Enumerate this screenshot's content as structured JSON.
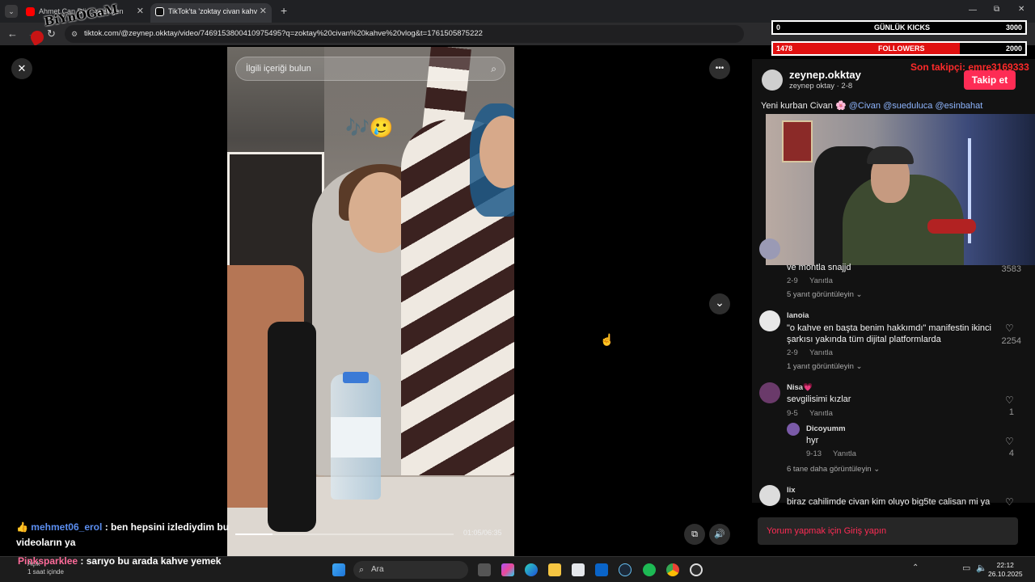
{
  "browser": {
    "tabs": [
      {
        "label": "Ahmet Can Dü... zgisi gen",
        "icon_color": "#ff0000"
      },
      {
        "label": "TikTok'ta 'zoktay civan kahv",
        "icon_color": "#ffffff"
      }
    ],
    "new_tab": "+",
    "url": "tiktok.com/@zeynep.okktay/video/7469153800410975495?q=zoktay%20civan%20kahve%20vlog&t=1761505875222",
    "window_controls": {
      "minimize": "—",
      "restore": "⧉",
      "close": "✕"
    }
  },
  "overlay_logo": "BiYnOGaM",
  "video": {
    "search_placeholder": "İlgili içeriği bulun",
    "time": "01:05/06:35",
    "progress": 0.17,
    "emoji": "🎶🥲",
    "close_icon": "✕",
    "more_icon": "•••",
    "chevron_icon": "⌄",
    "volume_icon": "🔊",
    "pip_icon": "⧉"
  },
  "stream": {
    "daily_kicks": {
      "label": "GÜNLÜK KICKS",
      "current": "0",
      "goal": "3000",
      "progress": 0.0
    },
    "followers": {
      "label": "FOLLOWERS",
      "current": "1478",
      "goal": "2000",
      "progress": 0.74
    },
    "last_follower": "Son takipçi: emre3169333"
  },
  "post": {
    "author": "zeynep.okktay",
    "author_sub": "zeynep oktay · 2-8",
    "follow": "Takip et",
    "desc_prefix": "Yeni kurban Civan",
    "mentions": [
      "@Civan",
      "@sueduluca",
      "@esinbahat"
    ]
  },
  "comments": [
    {
      "name": "",
      "text": "ve montla snajjd",
      "date": "2-9",
      "reply": "Yanıtla",
      "likes": "3583",
      "more": "5 yanıt görüntüleyin"
    },
    {
      "name": "lanoia",
      "text": "\"o kahve en başta benim hakkımdı\" manifestin ikinci şarkısı yakında tüm dijital platformlarda",
      "date": "2-9",
      "reply": "Yanıtla",
      "likes": "2254",
      "more": "1 yanıt görüntüleyin"
    },
    {
      "name": "Nisa💗",
      "text": "sevgilisimi kızlar",
      "date": "9-5",
      "reply": "Yanıtla",
      "likes": "1",
      "more": ""
    },
    {
      "name": "Dicoyumm",
      "text": "hyr",
      "date": "9-13",
      "reply": "Yanıtla",
      "likes": "4",
      "more": "6 tane daha görüntüleyin"
    },
    {
      "name": "lix",
      "text": "biraz cahilimde civan kim oluyo big5te calisan mi ya",
      "date": "",
      "reply": "",
      "likes": "",
      "more": ""
    }
  ],
  "login_prompt": "Yorum yapmak için Giriş yapın",
  "chat": [
    {
      "user": "mehmet06_erol",
      "msg": ": ben hepsini izlediydim bu videoların ya"
    },
    {
      "user": "Pinksparklee",
      "msg": ": sarıyo bu arada kahve yemek"
    }
  ],
  "taskbar": {
    "search": "Ara",
    "weather_label": "Açık",
    "weather_sub": "1 saat içinde",
    "time": "22:12",
    "date": "26.10.2025"
  }
}
